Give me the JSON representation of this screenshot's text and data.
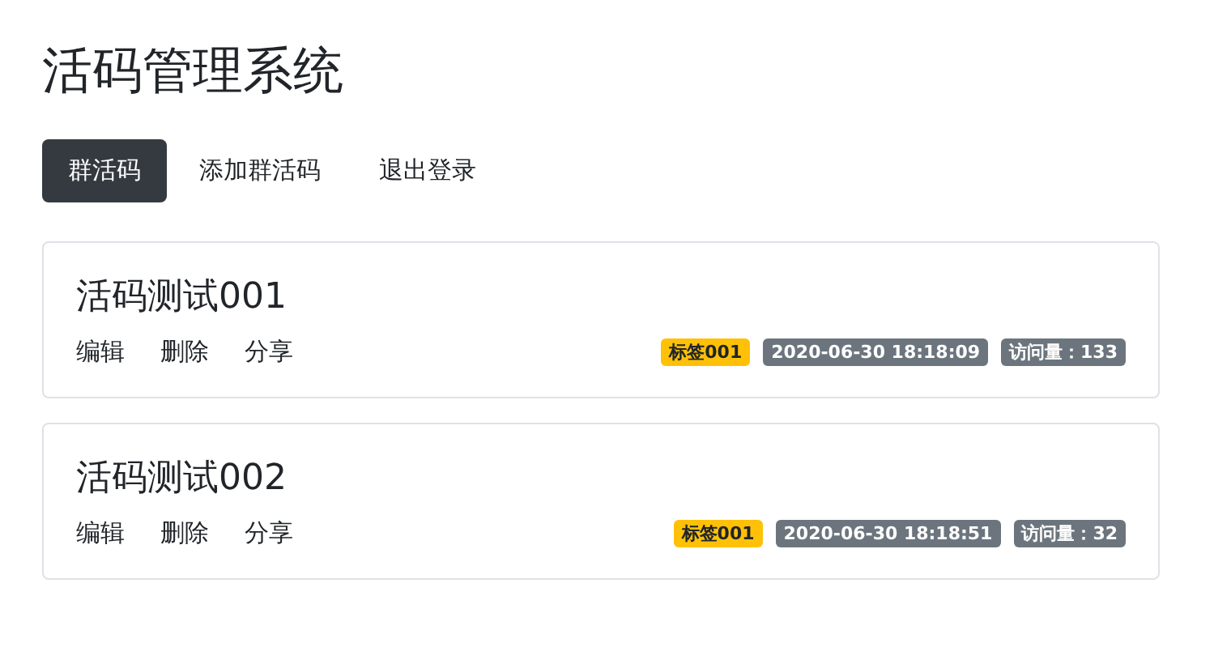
{
  "page_title": "活码管理系统",
  "nav": [
    {
      "label": "群活码",
      "selected": true
    },
    {
      "label": "添加群活码",
      "selected": false
    },
    {
      "label": "退出登录",
      "selected": false
    }
  ],
  "cards": [
    {
      "title": "活码测试001",
      "actions": [
        "编辑",
        "删除",
        "分享"
      ],
      "badges": [
        {
          "kind": "tag",
          "text": "标签001"
        },
        {
          "kind": "date",
          "text": "2020-06-30 18:18:09"
        },
        {
          "kind": "visits",
          "text": "访问量：133"
        }
      ]
    },
    {
      "title": "活码测试002",
      "actions": [
        "编辑",
        "删除",
        "分享"
      ],
      "badges": [
        {
          "kind": "tag",
          "text": "标签001"
        },
        {
          "kind": "date",
          "text": "2020-06-30 18:18:51"
        },
        {
          "kind": "visits",
          "text": "访问量：32"
        }
      ]
    }
  ]
}
